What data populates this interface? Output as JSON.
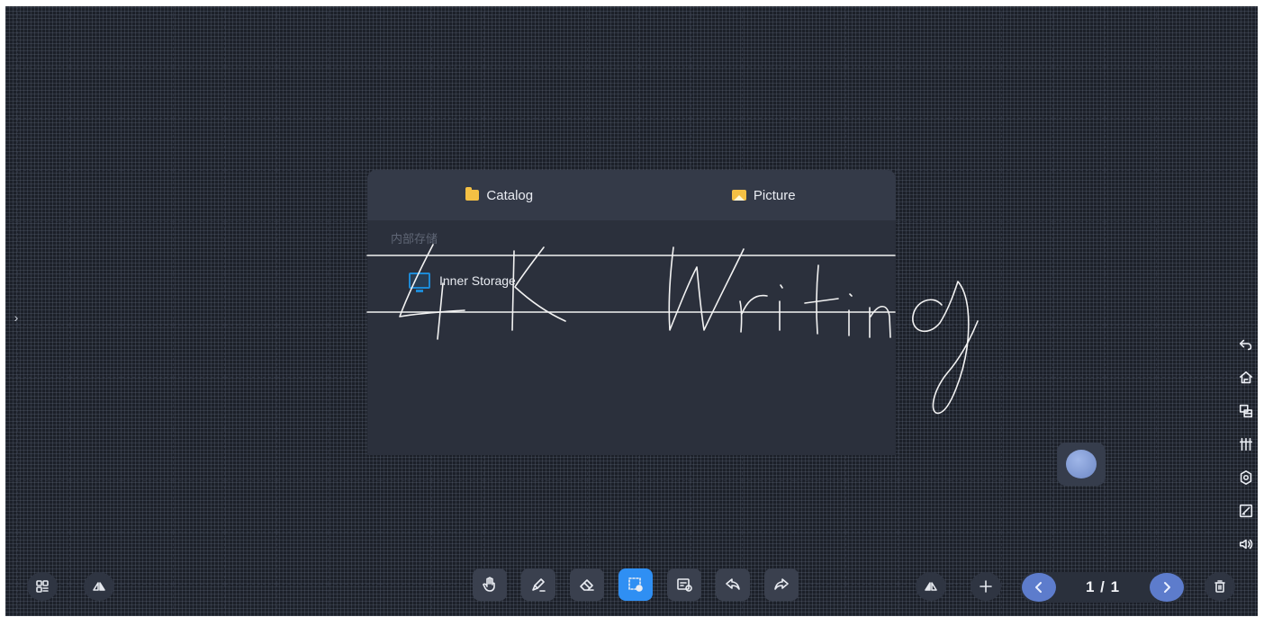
{
  "dialog": {
    "tabs": [
      {
        "label": "Catalog",
        "icon": "folder-icon"
      },
      {
        "label": "Picture",
        "icon": "picture-icon"
      }
    ],
    "subtitle": "内部存储",
    "storage_item": {
      "label": "Inner Storage",
      "icon": "monitor-icon"
    }
  },
  "handwriting": {
    "text": "4K Writing",
    "color": "#ffffff"
  },
  "right_toolbar": [
    "undo-icon",
    "home-icon",
    "window-icon",
    "pens-icon",
    "settings-icon",
    "note-edit-icon",
    "volume-icon"
  ],
  "bottom_toolbar": {
    "left": [
      "apps-icon",
      "triangle-tools-icon"
    ],
    "tools": [
      {
        "name": "hand-tool",
        "icon": "hand-icon",
        "active": false
      },
      {
        "name": "pen-tool",
        "icon": "pen-icon",
        "active": false
      },
      {
        "name": "eraser-tool",
        "icon": "eraser-icon",
        "active": false
      },
      {
        "name": "select-tool",
        "icon": "lasso-select-icon",
        "active": true
      },
      {
        "name": "insert-tool",
        "icon": "insert-media-icon",
        "active": false
      },
      {
        "name": "undo-tool",
        "icon": "undo-icon",
        "active": false
      },
      {
        "name": "redo-tool",
        "icon": "redo-icon",
        "active": false
      }
    ],
    "right": [
      "triangle-tools-icon",
      "add-page-icon"
    ]
  },
  "pager": {
    "indicator": "1 / 1"
  },
  "colors": {
    "board": "#1c2029",
    "accent": "#2f8ff3",
    "pager_button": "#5d7ccc",
    "folder": "#f4c044"
  }
}
